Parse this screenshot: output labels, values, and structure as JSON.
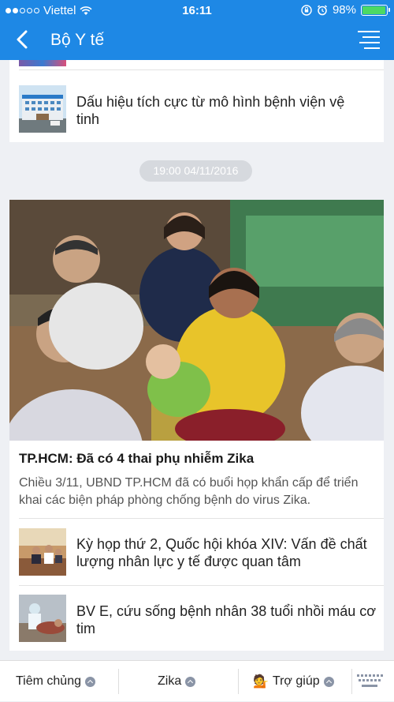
{
  "status": {
    "carrier": "Viettel",
    "time": "16:11",
    "battery": "98%",
    "battery_level": 0.98
  },
  "nav": {
    "title": "Bộ Y tế"
  },
  "articles_top": [
    {
      "title": "Dấu hiệu tích cực từ mô hình bệnh viện vệ tinh"
    }
  ],
  "timestamp": "19:00 04/11/2016",
  "feature": {
    "headline": "TP.HCM: Đã có 4 thai phụ nhiễm Zika",
    "summary": "Chiều 3/11, UBND TP.HCM đã có buổi họp khẩn cấp để triển khai các biện pháp phòng chống bệnh do virus Zika."
  },
  "related": [
    {
      "title": "Kỳ họp thứ 2, Quốc hội khóa XIV: Vấn đề chất lượng nhân lực y tế được quan tâm"
    },
    {
      "title": "BV E, cứu sống bệnh nhân 38 tuổi nhồi máu cơ tim"
    }
  ],
  "bottom_tabs": [
    {
      "label": "Tiêm chủng"
    },
    {
      "label": "Zika"
    },
    {
      "label": "Trợ giúp",
      "emoji": "💁"
    }
  ],
  "colors": {
    "accent": "#1e88e5",
    "background": "#eef0f4"
  },
  "icons": [
    "back-chevron-icon",
    "menu-icon",
    "wifi-icon",
    "alarm-icon",
    "orientation-lock-icon",
    "keyboard-icon"
  ]
}
